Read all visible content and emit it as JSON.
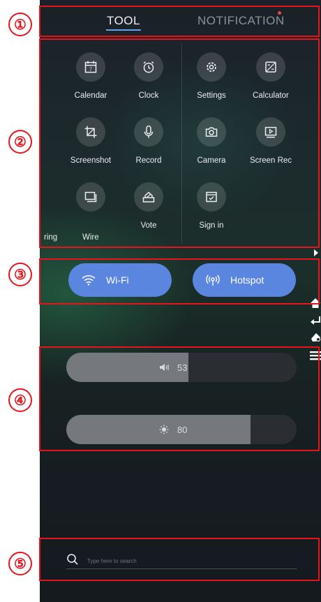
{
  "annotations": [
    "①",
    "②",
    "③",
    "④",
    "⑤"
  ],
  "tabs": [
    {
      "label": "TOOL",
      "active": true
    },
    {
      "label": "NOTIFICATION",
      "active": false
    }
  ],
  "tools": [
    {
      "label": "Calendar",
      "icon": "calendar-icon"
    },
    {
      "label": "Clock",
      "icon": "alarm-clock-icon"
    },
    {
      "label": "Settings",
      "icon": "gear-icon"
    },
    {
      "label": "Calculator",
      "icon": "calculator-icon"
    },
    {
      "label": "Screenshot",
      "icon": "crop-icon"
    },
    {
      "label": "Record",
      "icon": "microphone-icon"
    },
    {
      "label": "Camera",
      "icon": "camera-icon"
    },
    {
      "label": "Screen Rec",
      "icon": "screen-record-icon"
    },
    {
      "label": "ring",
      "icon": "screen-share-icon"
    },
    {
      "label": "Wire",
      "icon": ""
    },
    {
      "label": "Vote",
      "icon": "vote-icon"
    },
    {
      "label": "Sign in",
      "icon": "sign-in-icon"
    }
  ],
  "toggles": {
    "wifi": {
      "label": "Wi-Fi",
      "icon": "wifi-icon"
    },
    "hotspot": {
      "label": "Hotspot",
      "icon": "hotspot-icon"
    }
  },
  "volume": {
    "value": "53",
    "level": 0.53,
    "icon": "speaker-icon"
  },
  "brightness": {
    "value": "80",
    "level": 0.8,
    "icon": "sun-icon"
  },
  "search": {
    "placeholder": "Type here to search"
  },
  "side_icons": [
    "play-arrow-icon",
    "home-icon",
    "back-icon",
    "eraser-icon",
    "menu-icon"
  ],
  "colors": {
    "accent": "#5b86e0",
    "annotation": "#e8141b",
    "tab_underline": "#6ea0e8"
  }
}
